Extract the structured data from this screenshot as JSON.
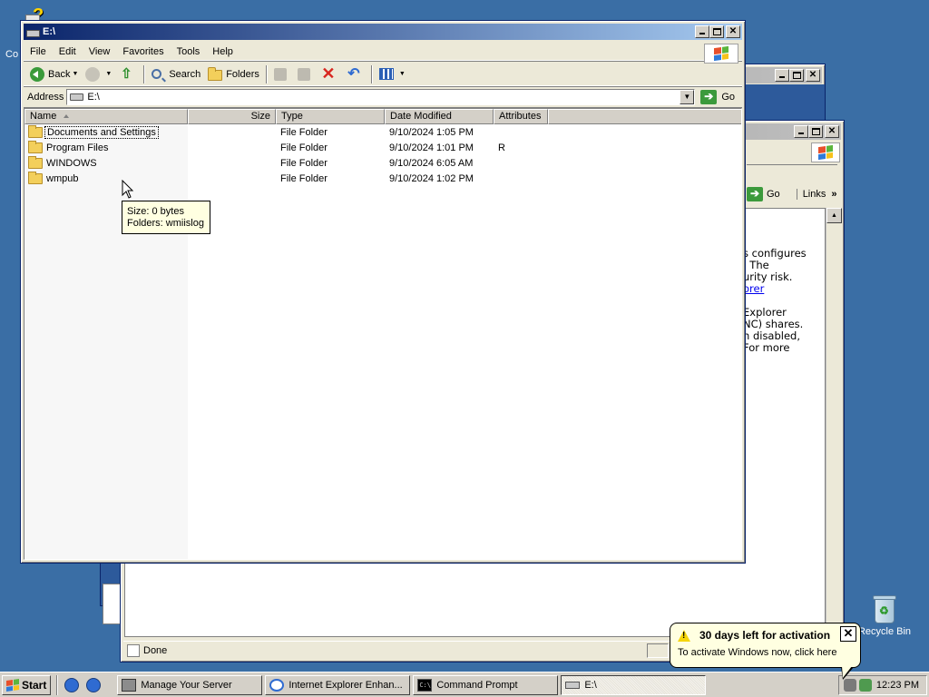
{
  "desktop": {
    "recycle_bin_label": "Recycle Bin",
    "my_computer_label": "Co"
  },
  "explorer": {
    "title": "E:\\",
    "menu": [
      "File",
      "Edit",
      "View",
      "Favorites",
      "Tools",
      "Help"
    ],
    "toolbar": {
      "back": "Back",
      "search": "Search",
      "folders": "Folders"
    },
    "address": {
      "label": "Address",
      "value": "E:\\",
      "go": "Go"
    },
    "columns": [
      "Name",
      "Size",
      "Type",
      "Date Modified",
      "Attributes"
    ],
    "rows": [
      {
        "name": "Documents and Settings",
        "size": "",
        "type": "File Folder",
        "date": "9/10/2024 1:05 PM",
        "attributes": ""
      },
      {
        "name": "Program Files",
        "size": "",
        "type": "File Folder",
        "date": "9/10/2024 1:01 PM",
        "attributes": "R"
      },
      {
        "name": "WINDOWS",
        "size": "",
        "type": "File Folder",
        "date": "9/10/2024 6:05 AM",
        "attributes": ""
      },
      {
        "name": "wmpub",
        "size": "",
        "type": "File Folder",
        "date": "9/10/2024 1:02 PM",
        "attributes": ""
      }
    ],
    "tooltip": {
      "line1": "Size: 0 bytes",
      "line2": "Folders: wmiislog"
    }
  },
  "browser_window": {
    "go": "Go",
    "links": "Links",
    "status": "Done",
    "text_lines_1": [
      "s configures",
      ". The",
      "urity risk.",
      "orer"
    ],
    "text_lines_2": [
      "Explorer",
      "NC) shares.",
      "n disabled,",
      "For more"
    ]
  },
  "taskbar": {
    "start": "Start",
    "tasks": [
      "Manage Your Server",
      "Internet Explorer Enhan...",
      "Command Prompt",
      "E:\\"
    ],
    "clock": "12:23 PM"
  },
  "balloon": {
    "title": "30 days left for activation",
    "message": "To activate Windows now, click here"
  }
}
